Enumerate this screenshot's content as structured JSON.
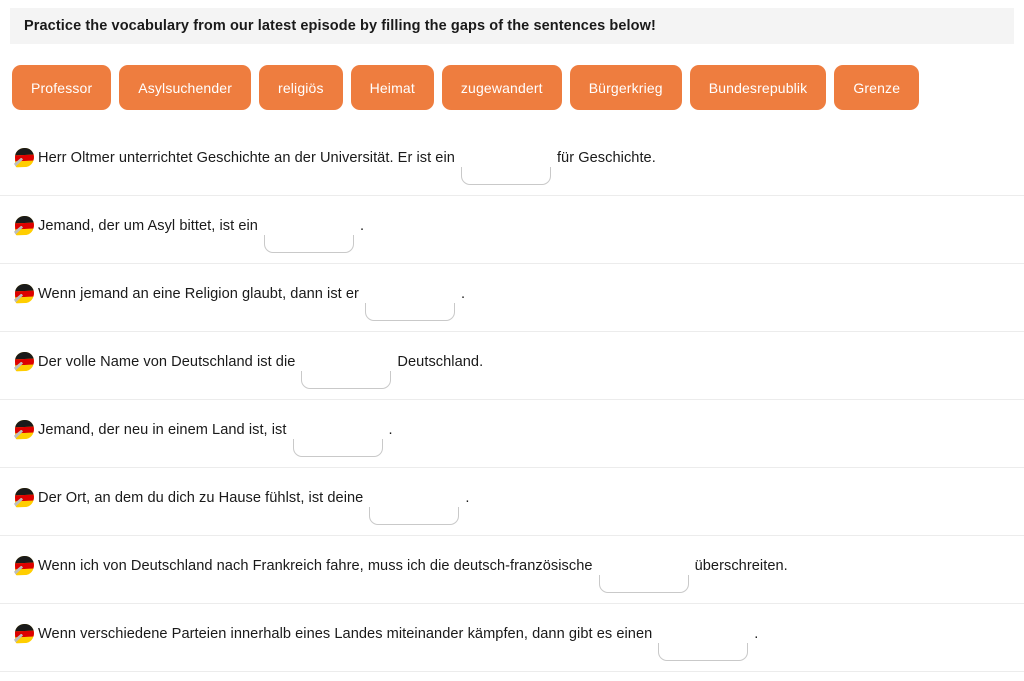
{
  "header": {
    "instruction": "Practice the vocabulary from our latest episode by filling the gaps of the sentences below!",
    "background_color": "#f4f4f4"
  },
  "word_bank": {
    "chip_color": "#ee7d3f",
    "chip_text_color": "#ffffff",
    "chips": [
      {
        "label": "Professor"
      },
      {
        "label": "Asylsuchender"
      },
      {
        "label": "religiös"
      },
      {
        "label": "Heimat"
      },
      {
        "label": "zugewandert"
      },
      {
        "label": "Bürgerkrieg"
      },
      {
        "label": "Bundesrepublik"
      },
      {
        "label": "Grenze"
      }
    ]
  },
  "sentences": [
    {
      "flag": "german-flag-icon",
      "before": "Herr Oltmer unterrichtet Geschichte an der Universität. Er ist ein",
      "gap_value": "",
      "gap_width": 90,
      "after": "für Geschichte."
    },
    {
      "flag": "german-flag-icon",
      "before": "Jemand, der um Asyl bittet, ist ein",
      "gap_value": "",
      "gap_width": 90,
      "after": "."
    },
    {
      "flag": "german-flag-icon",
      "before": "Wenn jemand an eine Religion glaubt, dann ist er",
      "gap_value": "",
      "gap_width": 90,
      "after": "."
    },
    {
      "flag": "german-flag-icon",
      "before": "Der volle Name von Deutschland ist die",
      "gap_value": "",
      "gap_width": 90,
      "after": "Deutschland."
    },
    {
      "flag": "german-flag-icon",
      "before": "Jemand, der neu in einem Land ist, ist",
      "gap_value": "",
      "gap_width": 90,
      "after": "."
    },
    {
      "flag": "german-flag-icon",
      "before": "Der Ort, an dem du dich zu Hause fühlst, ist deine",
      "gap_value": "",
      "gap_width": 90,
      "after": "."
    },
    {
      "flag": "german-flag-icon",
      "before": "Wenn ich von Deutschland nach Frankreich fahre, muss ich die deutsch-französische",
      "gap_value": "",
      "gap_width": 90,
      "after": "überschreiten."
    },
    {
      "flag": "german-flag-icon",
      "before": "Wenn verschiedene Parteien innerhalb eines Landes miteinander kämpfen, dann gibt es einen",
      "gap_value": "",
      "gap_width": 90,
      "after": "."
    }
  ]
}
